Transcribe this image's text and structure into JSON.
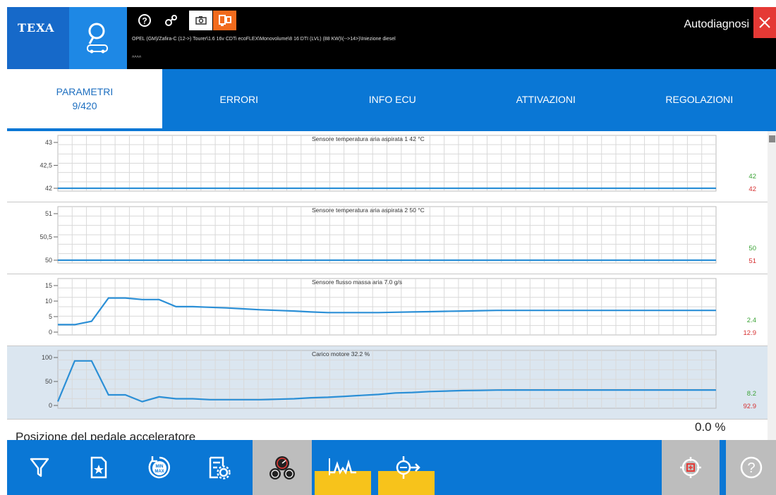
{
  "brand": "TEXA",
  "header": {
    "vehicle_info": "OPEL (GM)/Zafira-C (12->) Tourer\\1.6 16v CDTi ecoFLEX\\Monovolume\\8 16 DTI (LVL) (88 KW)\\(-->14>)\\Iniezione diesel",
    "vehicle_sub": "^^^^",
    "title": "Autodiagnosi",
    "icons": [
      "help-circle-icon",
      "connection-icon",
      "camera-icon",
      "vci-device-icon"
    ]
  },
  "tabs": {
    "parametri_label": "PARAMETRI",
    "parametri_count": "9/420",
    "errori": "ERRORI",
    "info_ecu": "INFO ECU",
    "attivazioni": "ATTIVAZIONI",
    "regolazioni": "REGOLAZIONI"
  },
  "colors": {
    "primary_blue": "#0a77d5",
    "line_blue": "#2b8fd6",
    "min_green": "#3aa335",
    "max_red": "#d63031",
    "selected_panel": "#dbe6f0",
    "accent_yellow": "#f7c31b"
  },
  "graphs": [
    {
      "title": "Sensore temperatura aria aspirata 1   42   °C",
      "y_ticks": [
        "43",
        "42,5",
        "42"
      ],
      "y_range": [
        42,
        43
      ],
      "values": [
        42,
        42,
        42,
        42,
        42,
        42,
        42,
        42,
        42,
        42,
        42,
        42,
        42,
        42,
        42,
        42,
        42,
        42,
        42,
        42
      ],
      "min_label": "42",
      "max_label": "42"
    },
    {
      "title": "Sensore temperatura aria aspirata 2   50   °C",
      "y_ticks": [
        "51",
        "50,5",
        "50"
      ],
      "y_range": [
        50,
        51
      ],
      "values": [
        50,
        50,
        50,
        50,
        50,
        50,
        50,
        50,
        50,
        50,
        50,
        50,
        50,
        50,
        50,
        50,
        50,
        50,
        50,
        50
      ],
      "min_label": "50",
      "max_label": "51"
    },
    {
      "title": "Sensore flusso massa aria   7.0   g/s",
      "y_ticks": [
        "15",
        "10",
        "5",
        "0"
      ],
      "y_range": [
        0,
        15
      ],
      "values": [
        2.4,
        2.4,
        3.5,
        11,
        11,
        10.5,
        10.5,
        8.2,
        8.2,
        8.0,
        7.8,
        7.5,
        7.2,
        7.0,
        6.8,
        6.5,
        6.3,
        6.3,
        6.3,
        6.3,
        6.4,
        6.5,
        6.6,
        6.7,
        6.8,
        6.9,
        7.0,
        7.0,
        7.0,
        7.0,
        7.0,
        7.0,
        7.0,
        7.0,
        7.0,
        7.0,
        7.0,
        7.0,
        7.0,
        7.0
      ],
      "min_label": "2.4",
      "max_label": "12.9"
    },
    {
      "title": "Carico motore   32.2   %",
      "y_ticks": [
        "100",
        "50",
        "0"
      ],
      "y_range": [
        0,
        100
      ],
      "values": [
        8.2,
        92.9,
        92.9,
        22,
        22,
        8,
        18,
        14,
        14,
        12,
        12,
        12,
        12,
        13,
        14,
        16,
        17,
        19,
        21,
        23,
        26,
        27,
        29,
        30,
        31,
        31.5,
        32,
        32.2,
        32.2,
        32.2,
        32.2,
        32.2,
        32.2,
        32.2,
        32.2,
        32.2,
        32.2,
        32.2,
        32.2,
        32.2
      ],
      "min_label": "8.2",
      "max_label": "92.9"
    }
  ],
  "next_param": {
    "name": "Posizione del pedale acceleratore",
    "value": "0.0 %"
  },
  "toolbar": {
    "buttons": [
      "filter-icon",
      "favorites-icon",
      "min-max-reset-icon",
      "settings-list-icon",
      "gauges-icon",
      "graph-view-icon",
      "export-icon",
      "target-icon",
      "help-icon"
    ]
  }
}
